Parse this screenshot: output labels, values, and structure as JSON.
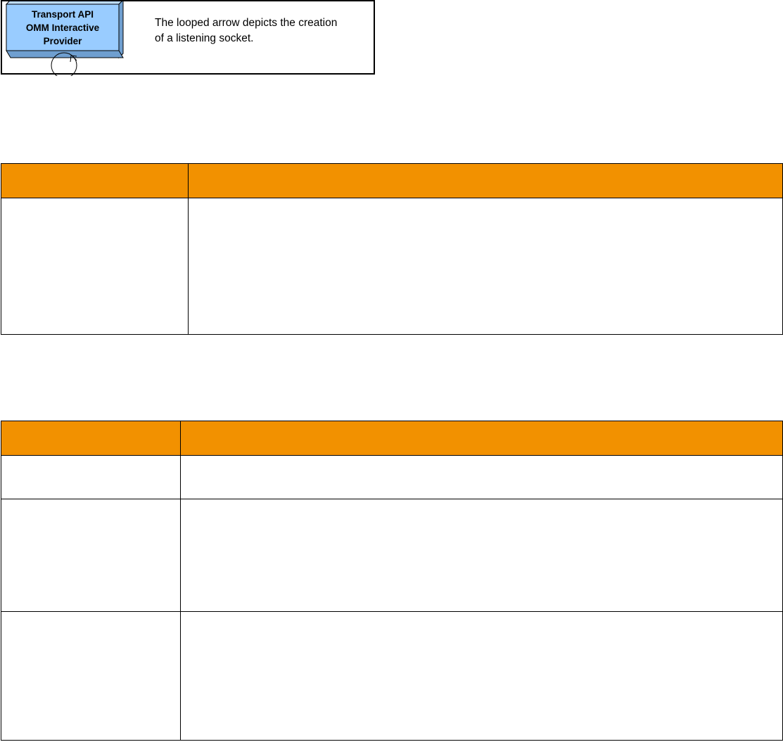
{
  "legend": {
    "component_lines": [
      "Transport  API",
      "OMM Interactive",
      "Provider"
    ],
    "description_lines": [
      "The looped arrow depicts the creation",
      "of a listening socket."
    ],
    "colors": {
      "box_fill": "#99ccff",
      "box_side": "#6699cc",
      "border": "#000000"
    }
  },
  "table1": {
    "header_color": "#f29100",
    "columns": [
      "",
      ""
    ],
    "rows": [
      [
        "",
        ""
      ]
    ]
  },
  "table2": {
    "header_color": "#f29100",
    "columns": [
      "",
      ""
    ],
    "rows": [
      [
        "",
        ""
      ],
      [
        "",
        ""
      ],
      [
        "",
        ""
      ]
    ]
  }
}
